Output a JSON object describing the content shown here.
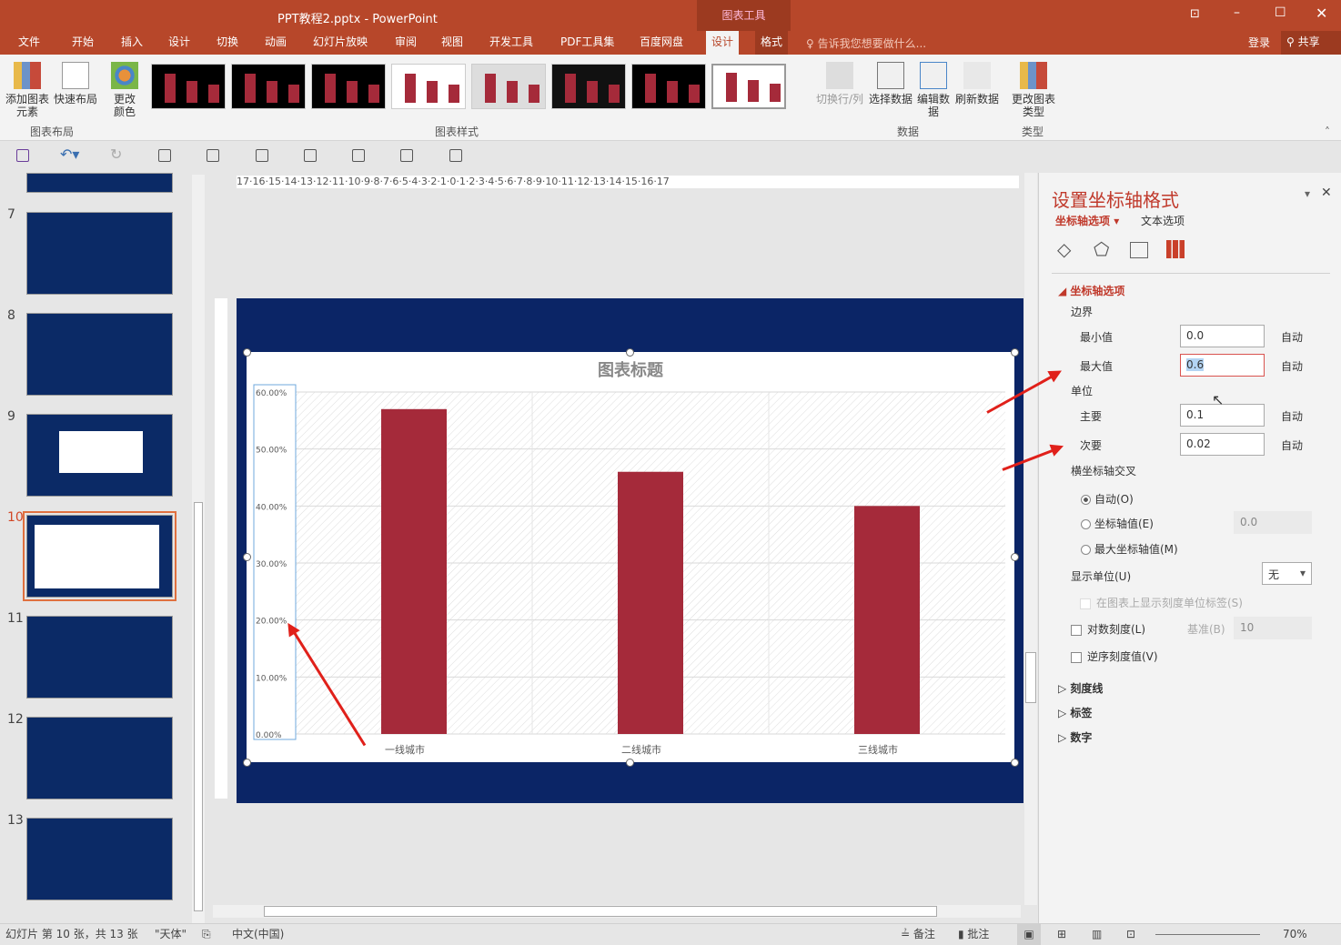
{
  "window": {
    "title": "PPT教程2.pptx - PowerPoint",
    "context_tool": "图表工具",
    "login": "登录",
    "share": "共享"
  },
  "tabs": [
    "文件",
    "开始",
    "插入",
    "设计",
    "切换",
    "动画",
    "幻灯片放映",
    "审阅",
    "视图",
    "开发工具",
    "PDF工具集",
    "百度网盘",
    "设计",
    "格式"
  ],
  "tell_me": "告诉我您想要做什么...",
  "ribbon": {
    "add_element": "添加图表元素",
    "quick_layout": "快速布局",
    "change_color": "更改颜色",
    "group_layout": "图表布局",
    "group_styles": "图表样式",
    "switch_rowcol": "切换行/列",
    "select_data": "选择数据",
    "edit_data": "编辑数据",
    "refresh_data": "刷新数据",
    "group_data": "数据",
    "change_type": "更改图表类型",
    "group_type": "类型"
  },
  "slides": [
    {
      "n": "7"
    },
    {
      "n": "8"
    },
    {
      "n": "9"
    },
    {
      "n": "10"
    },
    {
      "n": "11"
    },
    {
      "n": "12"
    },
    {
      "n": "13"
    }
  ],
  "ruler_h": "17·16·15·14·13·12·11·10·9·8·7·6·5·4·3·2·1·0·1·2·3·4·5·6·7·8·9·10·11·12·13·14·15·16·17",
  "chart_data": {
    "type": "bar",
    "title": "图表标题",
    "categories": [
      "一线城市",
      "二线城市",
      "三线城市"
    ],
    "values": [
      0.57,
      0.46,
      0.4
    ],
    "ylim": [
      0,
      0.6
    ],
    "yticks": [
      "0.00%",
      "10.00%",
      "20.00%",
      "30.00%",
      "40.00%",
      "50.00%",
      "60.00%"
    ],
    "bar_color": "#a52a3a",
    "grid": true
  },
  "pane": {
    "title": "设置坐标轴格式",
    "tab_axis": "坐标轴选项",
    "tab_text": "文本选项",
    "section": "坐标轴选项",
    "bounds": "边界",
    "min_label": "最小值",
    "min_value": "0.0",
    "max_label": "最大值",
    "max_value": "0.6",
    "auto": "自动",
    "units": "单位",
    "major_label": "主要",
    "major_value": "0.1",
    "minor_label": "次要",
    "minor_value": "0.02",
    "cross": "横坐标轴交叉",
    "r_auto": "自动(O)",
    "r_axis_value": "坐标轴值(E)",
    "axis_value": "0.0",
    "r_max": "最大坐标轴值(M)",
    "display_unit": "显示单位(U)",
    "display_unit_value": "无",
    "show_unit_label": "在图表上显示刻度单位标签(S)",
    "log_scale": "对数刻度(L)",
    "base_label": "基准(B)",
    "base_value": "10",
    "reverse": "逆序刻度值(V)",
    "tick_marks": "刻度线",
    "labels": "标签",
    "number": "数字",
    "accent": "#c0392b"
  },
  "status": {
    "slide": "幻灯片 第 10 张，共 13 张",
    "theme": "\"天体\"",
    "lang": "中文(中国)",
    "notes": "备注",
    "comments": "批注",
    "zoom": "70%"
  }
}
